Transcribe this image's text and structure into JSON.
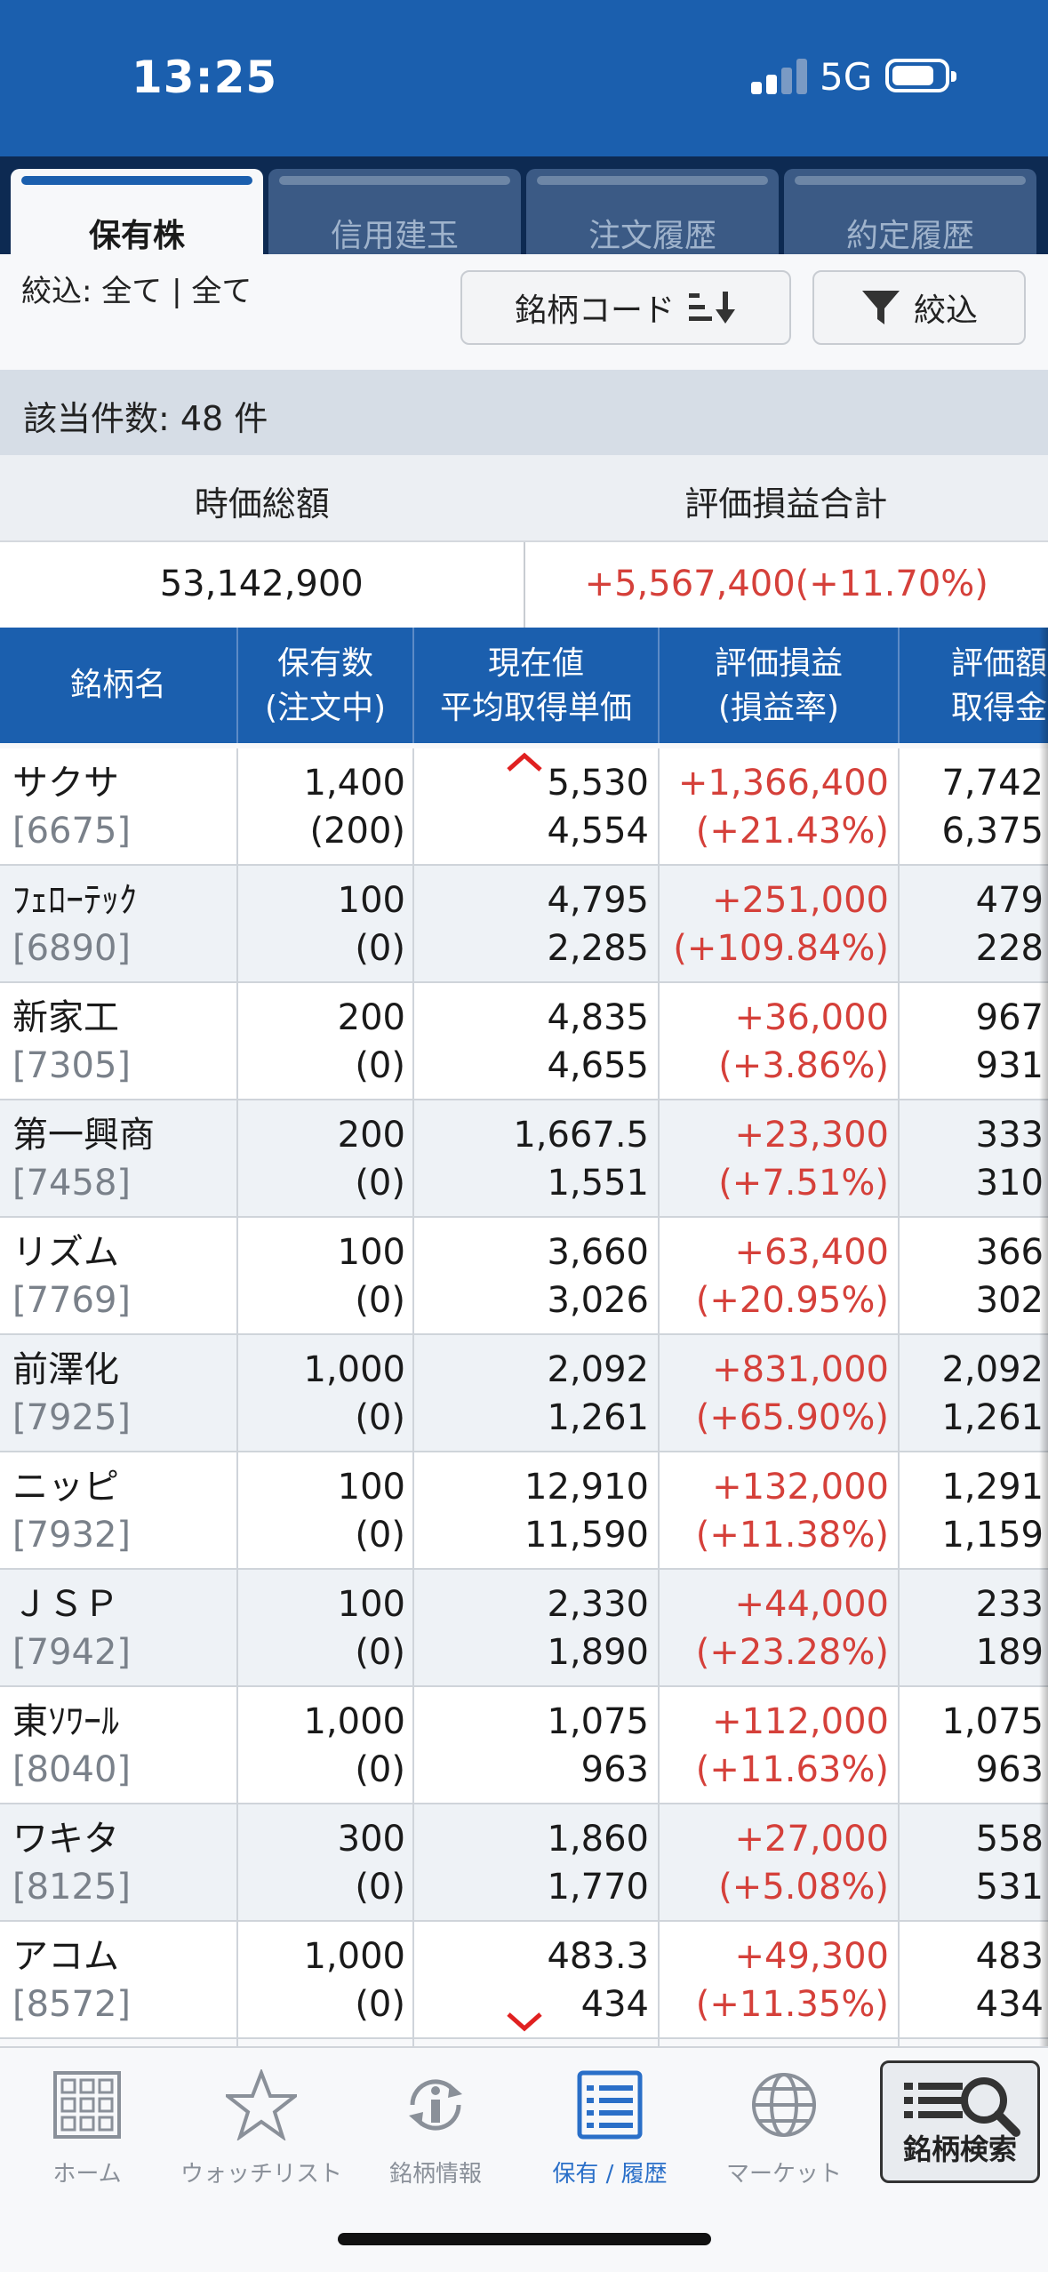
{
  "status_bar": {
    "time": "13:25",
    "network": "5G"
  },
  "tabs": [
    {
      "label": "保有株",
      "active": true
    },
    {
      "label": "信用建玉",
      "active": false
    },
    {
      "label": "注文履歴",
      "active": false
    },
    {
      "label": "約定履歴",
      "active": false
    }
  ],
  "filter": {
    "text": "絞込: 全て | 全て",
    "sort_button": "銘柄コード",
    "filter_button": "絞込"
  },
  "count": "該当件数: 48 件",
  "summary": {
    "market_value_label": "時価総額",
    "pnl_label": "評価損益合計",
    "market_value": "53,142,900",
    "pnl": "+5,567,400(+11.70%)"
  },
  "headers": {
    "name": "銘柄名",
    "qty1": "保有数",
    "qty2": "(注文中)",
    "price1": "現在値",
    "price2": "平均取得単価",
    "pnl1": "評価損益",
    "pnl2": "(損益率)",
    "val1": "評価額",
    "val2": "取得金"
  },
  "rows": [
    {
      "name": "サクサ",
      "code": "[6675]",
      "qty": "1,400",
      "ordering": "(200)",
      "price": "5,530",
      "avg": "4,554",
      "pnl": "+1,366,400",
      "rate": "(+21.43%)",
      "value": "7,742",
      "cost": "6,375"
    },
    {
      "name": "ﾌｪﾛｰﾃｯｸ",
      "code": "[6890]",
      "qty": "100",
      "ordering": "(0)",
      "price": "4,795",
      "avg": "2,285",
      "pnl": "+251,000",
      "rate": "(+109.84%)",
      "value": "479",
      "cost": "228"
    },
    {
      "name": "新家工",
      "code": "[7305]",
      "qty": "200",
      "ordering": "(0)",
      "price": "4,835",
      "avg": "4,655",
      "pnl": "+36,000",
      "rate": "(+3.86%)",
      "value": "967",
      "cost": "931"
    },
    {
      "name": "第一興商",
      "code": "[7458]",
      "qty": "200",
      "ordering": "(0)",
      "price": "1,667.5",
      "avg": "1,551",
      "pnl": "+23,300",
      "rate": "(+7.51%)",
      "value": "333",
      "cost": "310"
    },
    {
      "name": "リズム",
      "code": "[7769]",
      "qty": "100",
      "ordering": "(0)",
      "price": "3,660",
      "avg": "3,026",
      "pnl": "+63,400",
      "rate": "(+20.95%)",
      "value": "366",
      "cost": "302"
    },
    {
      "name": "前澤化",
      "code": "[7925]",
      "qty": "1,000",
      "ordering": "(0)",
      "price": "2,092",
      "avg": "1,261",
      "pnl": "+831,000",
      "rate": "(+65.90%)",
      "value": "2,092",
      "cost": "1,261"
    },
    {
      "name": "ニッピ",
      "code": "[7932]",
      "qty": "100",
      "ordering": "(0)",
      "price": "12,910",
      "avg": "11,590",
      "pnl": "+132,000",
      "rate": "(+11.38%)",
      "value": "1,291",
      "cost": "1,159"
    },
    {
      "name": "ＪＳＰ",
      "code": "[7942]",
      "qty": "100",
      "ordering": "(0)",
      "price": "2,330",
      "avg": "1,890",
      "pnl": "+44,000",
      "rate": "(+23.28%)",
      "value": "233",
      "cost": "189"
    },
    {
      "name": "東ｿﾜｰﾙ",
      "code": "[8040]",
      "qty": "1,000",
      "ordering": "(0)",
      "price": "1,075",
      "avg": "963",
      "pnl": "+112,000",
      "rate": "(+11.63%)",
      "value": "1,075",
      "cost": "963"
    },
    {
      "name": "ワキタ",
      "code": "[8125]",
      "qty": "300",
      "ordering": "(0)",
      "price": "1,860",
      "avg": "1,770",
      "pnl": "+27,000",
      "rate": "(+5.08%)",
      "value": "558",
      "cost": "531"
    },
    {
      "name": "アコム",
      "code": "[8572]",
      "qty": "1,000",
      "ordering": "(0)",
      "price": "483.3",
      "avg": "434",
      "pnl": "+49,300",
      "rate": "(+11.35%)",
      "value": "483",
      "cost": "434"
    }
  ],
  "bottom_nav": [
    {
      "label": "ホーム",
      "icon": "grid-icon"
    },
    {
      "label": "ウォッチリスト",
      "icon": "star-icon"
    },
    {
      "label": "銘柄情報",
      "icon": "info-refresh-icon"
    },
    {
      "label": "保有 / 履歴",
      "icon": "list-icon",
      "active": true
    },
    {
      "label": "マーケット",
      "icon": "globe-icon"
    }
  ],
  "search_button": "銘柄検索",
  "colors": {
    "header_blue": "#1b5fae",
    "tab_bar": "#0d2a52",
    "profit_red": "#d5403a",
    "active_blue": "#2a6fc8"
  }
}
